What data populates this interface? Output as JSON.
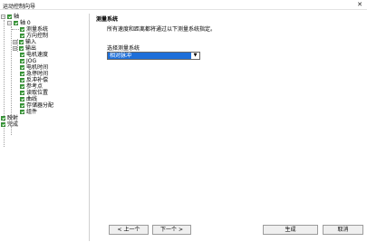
{
  "window": {
    "title": "运动控制向导"
  },
  "tree": {
    "items": [
      {
        "label": "轴"
      },
      {
        "label": "轴 0"
      },
      {
        "label": "测量系统"
      },
      {
        "label": "方向控制"
      },
      {
        "label": "输入"
      },
      {
        "label": "输出"
      },
      {
        "label": "电机速度"
      },
      {
        "label": "JOG"
      },
      {
        "label": "电机时间"
      },
      {
        "label": "急停时间"
      },
      {
        "label": "反冲补偿"
      },
      {
        "label": "参考点"
      },
      {
        "label": "读取位置"
      },
      {
        "label": "曲线"
      },
      {
        "label": "存储器分配"
      },
      {
        "label": "组件"
      },
      {
        "label": "映射"
      },
      {
        "label": "完成"
      }
    ]
  },
  "main": {
    "heading": "测量系统",
    "description": "所有速度和距离都将通过以下测量系统指定。",
    "select_label": "选择测量系统",
    "select_value": "相对脉冲"
  },
  "footer": {
    "prev_label": "< 上一个",
    "next_label": "下一个 >",
    "generate_label": "生成",
    "cancel_label": "取消"
  }
}
